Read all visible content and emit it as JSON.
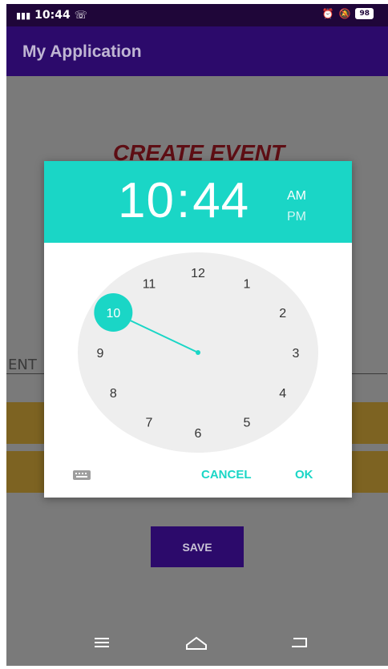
{
  "status_bar": {
    "time": "10:44",
    "signal": "H",
    "battery": "98"
  },
  "app_bar": {
    "title": "My Application"
  },
  "background": {
    "heading": "CREATE EVENT",
    "entry_field_text": "ENT",
    "save_label": "SAVE"
  },
  "time_picker": {
    "hour": "10",
    "separator": ":",
    "minute": "44",
    "am_label": "AM",
    "pm_label": "PM",
    "selected_period": "AM",
    "selected_hour": "10",
    "hour_numbers": [
      "12",
      "1",
      "2",
      "3",
      "4",
      "5",
      "6",
      "7",
      "8",
      "9",
      "10",
      "11"
    ],
    "cancel_label": "CANCEL",
    "ok_label": "OK",
    "accent_color": "#1ad6c6"
  },
  "colors": {
    "status_bar": "#1f0639",
    "app_bar": "#2c0a6b",
    "heading": "#5e0e14",
    "band": "#7d6322"
  },
  "icons": [
    "call-icon",
    "alarm-icon",
    "mute-icon",
    "battery-icon",
    "keyboard-icon",
    "menu-icon",
    "home-icon",
    "back-icon"
  ]
}
